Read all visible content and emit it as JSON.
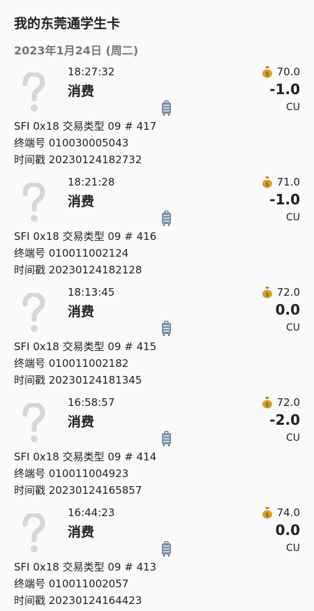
{
  "card": {
    "title": "我的东莞通学生卡"
  },
  "date_header": "2023年1月24日 (周二)",
  "trips": [
    {
      "time": "18:27:32",
      "type": "消费",
      "balance": "70.0",
      "fare": "-1.0",
      "currency": "CU",
      "sfi": "SFI 0x18  交易类型 09  # 417",
      "terminal": "终端号 010030005043",
      "timestamp": "时间戳 20230124182732"
    },
    {
      "time": "18:21:28",
      "type": "消费",
      "balance": "71.0",
      "fare": "-1.0",
      "currency": "CU",
      "sfi": "SFI 0x18  交易类型 09  # 416",
      "terminal": "终端号 010011002124",
      "timestamp": "时间戳 20230124182128"
    },
    {
      "time": "18:13:45",
      "type": "消费",
      "balance": "72.0",
      "fare": "0.0",
      "currency": "CU",
      "sfi": "SFI 0x18  交易类型 09  # 415",
      "terminal": "终端号 010011002182",
      "timestamp": "时间戳 20230124181345"
    },
    {
      "time": "16:58:57",
      "type": "消费",
      "balance": "72.0",
      "fare": "-2.0",
      "currency": "CU",
      "sfi": "SFI 0x18  交易类型 09  # 414",
      "terminal": "终端号 010011004923",
      "timestamp": "时间戳 20230124165857"
    },
    {
      "time": "16:44:23",
      "type": "消费",
      "balance": "74.0",
      "fare": "0.0",
      "currency": "CU",
      "sfi": "SFI 0x18  交易类型 09  # 413",
      "terminal": "终端号 010011002057",
      "timestamp": "时间戳 20230124164423"
    }
  ],
  "icons": {
    "mode": "question-mark-icon",
    "balance": "money-bag-icon",
    "transport": "luggage-icon"
  }
}
